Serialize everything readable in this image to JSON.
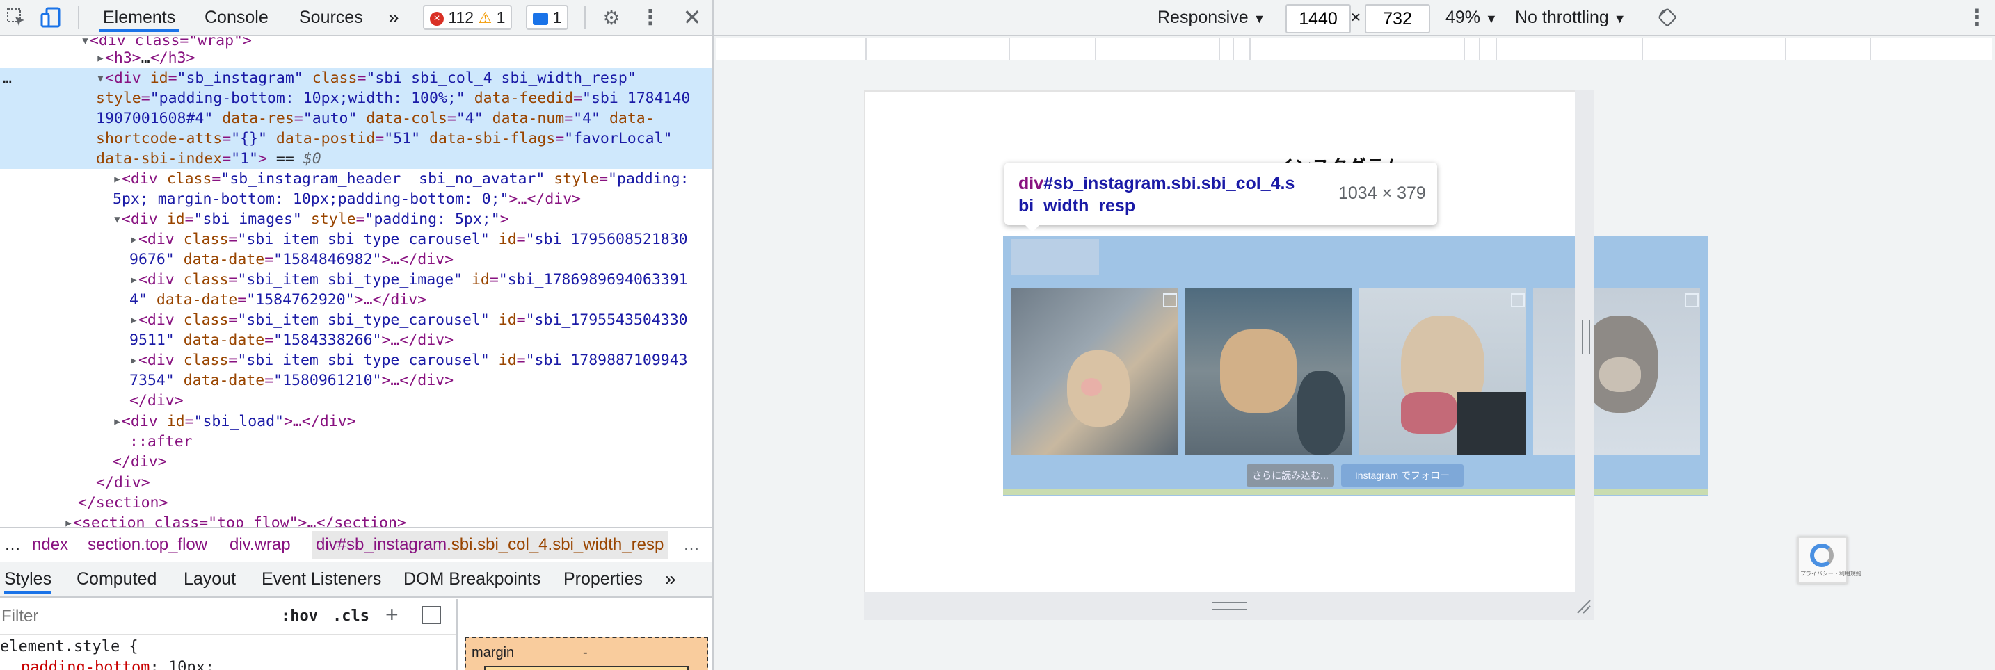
{
  "toolbar": {
    "tabs": [
      "Elements",
      "Console",
      "Sources"
    ],
    "more_tabs": "»",
    "error_count": "112",
    "warning_count": "1",
    "message_count": "1"
  },
  "dom": {
    "line0_tag": "<div class=\"wrap\">",
    "line1_tag": "<h3>",
    "line1_mid": "…",
    "line1_end": "</h3>",
    "sel_dots": "…",
    "sel_l1_tag": "<div ",
    "sel_l1_a1": "id",
    "sel_l1_v1": "\"sb_instagram\"",
    "sel_l1_a2": "class",
    "sel_l1_v2": "\"sbi sbi_col_4 sbi_width_resp\"",
    "sel_l2_a1": "style",
    "sel_l2_v1": "\"padding-bottom: 10px;width: 100%;\"",
    "sel_l2_a2": "data-feedid",
    "sel_l2_v2": "\"sbi_1784140",
    "sel_l3_v2": "1907001608#4\"",
    "sel_l3_a3": "data-res",
    "sel_l3_v3": "\"auto\"",
    "sel_l3_a4": "data-cols",
    "sel_l3_v4": "\"4\"",
    "sel_l3_a5": "data-num",
    "sel_l3_v5": "\"4\"",
    "sel_l3_a6": "data-",
    "sel_l4_a6": "shortcode-atts",
    "sel_l4_v6": "\"{}\"",
    "sel_l4_a7": "data-postid",
    "sel_l4_v7": "\"51\"",
    "sel_l4_a8": "data-sbi-flags",
    "sel_l4_v8": "\"favorLocal\"",
    "sel_l5_a9": "data-sbi-index",
    "sel_l5_v9": "\"1\"",
    "sel_l5_end": ">",
    "sel_l5_eq": " == ",
    "sel_l5_dollar": "$0",
    "hdr_l1_tag": "<div ",
    "hdr_l1_a1": "class",
    "hdr_l1_v1": "\"sb_instagram_header  sbi_no_avatar\"",
    "hdr_l1_a2": "style",
    "hdr_l1_v2": "\"padding:",
    "hdr_l2_v2": "5px; margin-bottom: 10px;padding-bottom: 0;\"",
    "hdr_l2_end": ">…</div>",
    "imgs_tag": "<div ",
    "imgs_a1": "id",
    "imgs_v1": "\"sbi_images\"",
    "imgs_a2": "style",
    "imgs_v2": "\"padding: 5px;\"",
    "imgs_end": ">",
    "items": [
      {
        "cls": "\"sbi_item sbi_type_carousel\"",
        "id1": "\"sbi_1795608521830",
        "id2": "9676\"",
        "date": "\"1584846982\""
      },
      {
        "cls": "\"sbi_item sbi_type_image\"",
        "id1": "\"sbi_1786989694063391",
        "id2": "4\"",
        "date": "\"1584762920\""
      },
      {
        "cls": "\"sbi_item sbi_type_carousel\"",
        "id1": "\"sbi_1795543504330",
        "id2": "9511\"",
        "date": "\"1584338266\""
      },
      {
        "cls": "\"sbi_item sbi_type_carousel\"",
        "id1": "\"sbi_1789887109943",
        "id2": "7354\"",
        "date": "\"1580961210\""
      }
    ],
    "item_open": "<div ",
    "item_a_cls": "class",
    "item_a_id": "id",
    "item_a_date": "data-date",
    "item_close": ">…</div>",
    "close_div": "</div>",
    "load_tag": "<div ",
    "load_a": "id",
    "load_v": "\"sbi_load\"",
    "load_end": ">…</div>",
    "after": "::after",
    "close_section": "</section>",
    "last_tag": "<section class=\"top_flow\">…</section>"
  },
  "breadcrumbs": {
    "lead": "…",
    "items": [
      "ndex",
      "section.top_flow",
      "div.wrap"
    ],
    "current_tag": "div",
    "current_id": "#sb_instagram",
    "current_cls": ".sbi.sbi_col_4.sbi_width_resp",
    "trail": "…"
  },
  "styles_tabs": [
    "Styles",
    "Computed",
    "Layout",
    "Event Listeners",
    "DOM Breakpoints",
    "Properties"
  ],
  "styles_more": "»",
  "filter": {
    "placeholder": "Filter",
    "hov": ":hov",
    "cls": ".cls"
  },
  "styles_code": {
    "selector": "element.style {",
    "prop": "padding-bottom",
    "val": "10px;"
  },
  "boxmodel": {
    "label": "margin",
    "value": "-"
  },
  "device": {
    "mode": "Responsive",
    "width": "1440",
    "times": "×",
    "height": "732",
    "zoom": "49%",
    "throttle": "No throttling"
  },
  "tooltip": {
    "tag": "div",
    "id": "#sb_instagram",
    "cls1": ".sbi.sbi_col_4.s",
    "cls2": "bi_width_resp",
    "size": "1034 × 379"
  },
  "page": {
    "heading": "インスタグラム",
    "load_more": "さらに読み込む...",
    "follow": "Instagram でフォロー",
    "recaptcha": "プライバシー・利用規約"
  },
  "colors": {
    "accent": "#1a73e8",
    "highlight": "#a0c4e6",
    "selection": "#cfe8fc"
  }
}
